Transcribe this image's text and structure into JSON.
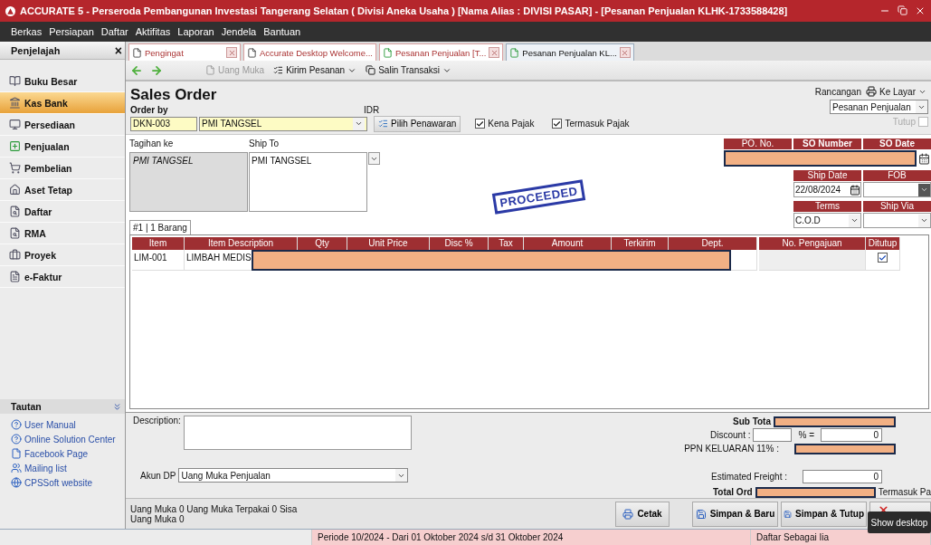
{
  "window": {
    "title": "ACCURATE 5  - Perseroda Pembangunan Investasi Tangerang Selatan ( Divisi Aneka Usaha )   [Nama Alias : DIVISI PASAR] - [Pesanan Penjualan KLHK-1733588428]"
  },
  "menu": [
    "Berkas",
    "Persiapan",
    "Daftar",
    "Aktifitas",
    "Laporan",
    "Jendela",
    "Bantuan"
  ],
  "sidebar": {
    "title": "Penjelajah",
    "close": "×",
    "items": [
      {
        "label": "Buku Besar",
        "selected": false
      },
      {
        "label": "Kas Bank",
        "selected": true
      },
      {
        "label": "Persediaan",
        "selected": false
      },
      {
        "label": "Penjualan",
        "selected": false
      },
      {
        "label": "Pembelian",
        "selected": false
      },
      {
        "label": "Aset Tetap",
        "selected": false
      },
      {
        "label": "Daftar",
        "selected": false
      },
      {
        "label": "RMA",
        "selected": false
      },
      {
        "label": "Proyek",
        "selected": false
      },
      {
        "label": "e-Faktur",
        "selected": false
      }
    ],
    "links_title": "Tautan",
    "links": [
      "User Manual",
      "Online Solution Center",
      "Facebook Page",
      "Mailing list",
      "CPSSoft website"
    ]
  },
  "tabs": [
    {
      "label": "Pengingat",
      "selected": false,
      "closable": true
    },
    {
      "label": "Accurate Desktop Welcome...",
      "selected": false,
      "closable": false
    },
    {
      "label": "Pesanan Penjualan [T...",
      "selected": false,
      "closable": true
    },
    {
      "label": "Pesanan Penjualan KL...",
      "selected": true,
      "closable": true
    }
  ],
  "toolbar": [
    {
      "label": "Uang Muka",
      "disabled": true,
      "dropdown": false
    },
    {
      "label": "Kirim Pesanan",
      "disabled": false,
      "dropdown": true
    },
    {
      "label": "Salin Transaksi",
      "disabled": false,
      "dropdown": true
    }
  ],
  "form": {
    "title": "Sales Order",
    "order_by_label": "Order by",
    "customer_code": "DKN-003",
    "customer_name": "PMI TANGSEL",
    "currency": "IDR",
    "pick_quote_button": "Pilih Penawaran",
    "checkboxes": [
      {
        "label": "Kena Pajak",
        "checked": true
      },
      {
        "label": "Termasuk Pajak",
        "checked": true
      }
    ],
    "design_label": "Rancangan",
    "screen_button": "Ke Layar",
    "design_select": "Pesanan Penjualan",
    "close_option": {
      "label": "Tutup",
      "checked": false,
      "disabled": true
    }
  },
  "bill_to": {
    "label": "Tagihan ke",
    "value": "PMI TANGSEL"
  },
  "ship_to": {
    "label": "Ship To",
    "value": "PMI TANGSEL"
  },
  "stamp": "PROCEEDED",
  "header_fields": {
    "po_no_label": "PO. No.",
    "so_number_label": "SO Number",
    "so_date_label": "SO Date",
    "ship_date_label": "Ship Date",
    "ship_date": "22/08/2024",
    "fob_label": "FOB",
    "terms_label": "Terms",
    "terms": "C.O.D",
    "ship_via_label": "Ship Via"
  },
  "detail_tab": "#1 | 1 Barang",
  "table": {
    "columns": [
      "Item",
      "Item Description",
      "Qty",
      "Unit Price",
      "Disc %",
      "Tax",
      "Amount",
      "Terkirim",
      "Dept.",
      "No. Pengajuan",
      "Ditutup"
    ],
    "rows": [
      {
        "item": "LIM-001",
        "description": "LIMBAH MEDIS",
        "closed": true
      }
    ]
  },
  "description_label": "Description:",
  "dp_account_label": "Akun DP",
  "dp_account": "Uang Muka Penjualan",
  "totals": {
    "subtotal_label": "Sub Tota",
    "discount_label": "Discount :",
    "percent_label": "% =",
    "discount_amount": "0",
    "tax_label": "PPN KELUARAN 11% :",
    "freight_label": "Estimated Freight :",
    "freight": "0",
    "total_label": "Total Ord",
    "tax_included_label": "Termasuk Pa"
  },
  "down_payment_summary": "Uang Muka 0   Uang Muka Terpakai 0   Sisa Uang Muka 0",
  "buttons": [
    "Cetak",
    "Simpan & Baru",
    "Simpan & Tutup"
  ],
  "status_bar": {
    "period": "Periode 10/2024 - Dari 01 Oktober 2024 s/d 31 Oktober 2024",
    "registration": "Daftar Sebagai Iia"
  },
  "tooltip": "Show desktop"
}
